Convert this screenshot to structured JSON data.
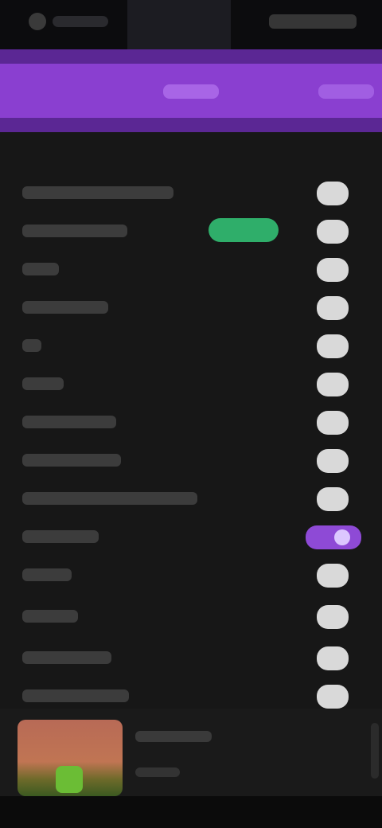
{
  "app_bar": {
    "tabs": [
      {
        "label": ""
      },
      {
        "label": ""
      }
    ]
  },
  "list": {
    "rows": [
      {
        "label": "",
        "toggle": "on",
        "tag": ""
      },
      {
        "label": "",
        "toggle": "on",
        "tag": ""
      },
      {
        "label": "",
        "toggle": "on"
      },
      {
        "label": "",
        "toggle": "on"
      },
      {
        "label": "",
        "toggle": "on"
      },
      {
        "label": "",
        "toggle": "on"
      },
      {
        "label": "",
        "toggle": "on"
      },
      {
        "label": "",
        "toggle": "on"
      },
      {
        "label": "",
        "toggle": "on"
      },
      {
        "label": "",
        "toggle": "on"
      },
      {
        "label": "",
        "toggle": "on"
      },
      {
        "label": "",
        "toggle": "on"
      },
      {
        "label": "",
        "toggle": "on"
      },
      {
        "label": "",
        "toggle": "on"
      }
    ]
  },
  "bottom_card": {
    "title": "",
    "subtitle": ""
  },
  "colors": {
    "accent": "#8a3fd0",
    "tag": "#2fae6a",
    "background": "#171717"
  },
  "icons": {
    "status_left": "app-icon",
    "toggle": "toggle-icon",
    "thumbnail": "thumbnail-image"
  }
}
